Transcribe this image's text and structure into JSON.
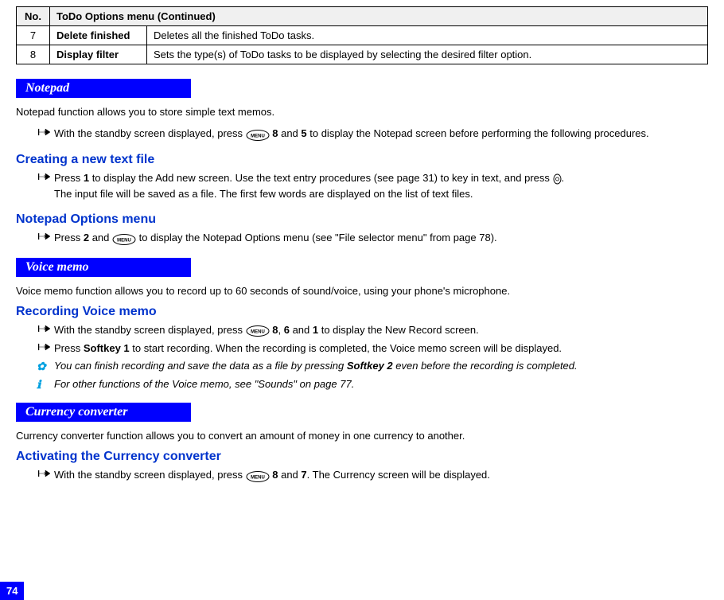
{
  "table": {
    "headers": {
      "no": "No.",
      "menu": "ToDo Options menu (Continued)"
    },
    "rows": [
      {
        "no": "7",
        "option": "Delete finished",
        "desc": "Deletes all the finished ToDo tasks."
      },
      {
        "no": "8",
        "option": "Display filter",
        "desc": "Sets the type(s) of ToDo tasks to be displayed by selecting the desired filter option."
      }
    ]
  },
  "notepad": {
    "title": "Notepad",
    "intro": "Notepad function allows you to store simple text memos.",
    "intro_bullet_pre": "With the standby screen displayed, press ",
    "intro_bullet_mid1": " ",
    "intro_bullet_key1": "8",
    "intro_bullet_and": " and ",
    "intro_bullet_key2": "5",
    "intro_bullet_post": " to display the Notepad screen before performing the following procedures.",
    "creating": {
      "heading": "Creating a new text file",
      "line1_pre": "Press ",
      "line1_key": "1",
      "line1_mid": " to display the Add new screen. Use the text entry procedures (see page 31) to key in text, and press ",
      "line1_post": ".",
      "line2": "The input file will be saved as a file. The first few words are displayed on the list of text files."
    },
    "options": {
      "heading": "Notepad Options menu",
      "line_pre": "Press ",
      "line_key": "2",
      "line_and": " and ",
      "line_post": " to display the Notepad Options menu (see \"File selector menu\" from page 78)."
    }
  },
  "voicememo": {
    "title": "Voice memo",
    "intro": "Voice memo function allows you to record up to 60 seconds of sound/voice, using your phone's microphone.",
    "recording": {
      "heading": "Recording Voice memo",
      "b1_pre": "With the standby screen displayed, press ",
      "b1_k1": "8",
      "b1_c1": ", ",
      "b1_k2": "6",
      "b1_and": " and ",
      "b1_k3": "1",
      "b1_post": " to display the New Record screen.",
      "b2_pre": "Press ",
      "b2_sk": "Softkey 1",
      "b2_post": " to start recording. When the recording is completed, the Voice memo screen will be displayed.",
      "b3_pre": "You can finish recording and save the data as a file by pressing ",
      "b3_sk": "Softkey 2",
      "b3_post": " even before the recording is completed.",
      "b4": "For other functions of the Voice memo, see \"Sounds\" on page 77."
    }
  },
  "currency": {
    "title": "Currency converter",
    "intro": "Currency converter function allows you to convert an amount of money in one currency to another.",
    "activating": {
      "heading": "Activating the Currency converter",
      "line_pre": "With the standby screen displayed, press ",
      "line_k1": "8",
      "line_and": " and ",
      "line_k2": "7",
      "line_post": ". The Currency screen will be displayed."
    }
  },
  "page_number": "74",
  "icons": {
    "menu_label": "MENU"
  }
}
